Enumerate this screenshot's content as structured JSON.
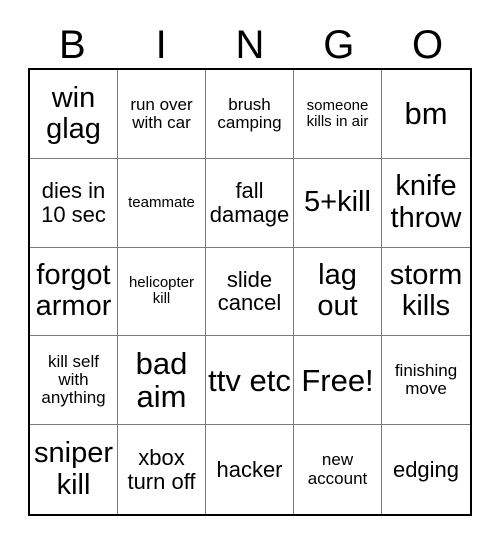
{
  "header": {
    "letters": [
      "B",
      "I",
      "N",
      "G",
      "O"
    ]
  },
  "grid": {
    "columns": 5,
    "rows": 5,
    "cells": [
      {
        "text": "win glag",
        "size": "fs-lg"
      },
      {
        "text": "run over with car",
        "size": "fs-sm"
      },
      {
        "text": "brush camping",
        "size": "fs-sm"
      },
      {
        "text": "someone kills in air",
        "size": "fs-xs"
      },
      {
        "text": "bm",
        "size": "fs-xl"
      },
      {
        "text": "dies in 10 sec",
        "size": "fs-md"
      },
      {
        "text": "teammate",
        "size": "fs-xs"
      },
      {
        "text": "fall damage",
        "size": "fs-md"
      },
      {
        "text": "5+kill",
        "size": "fs-lg"
      },
      {
        "text": "knife throw",
        "size": "fs-lg"
      },
      {
        "text": "forgot armor",
        "size": "fs-lg"
      },
      {
        "text": "helicopter kill",
        "size": "fs-xs"
      },
      {
        "text": "slide cancel",
        "size": "fs-md"
      },
      {
        "text": "lag out",
        "size": "fs-lg"
      },
      {
        "text": "storm kills",
        "size": "fs-lg"
      },
      {
        "text": "kill self with anything",
        "size": "fs-sm"
      },
      {
        "text": "bad aim",
        "size": "fs-xl"
      },
      {
        "text": "ttv etc",
        "size": "fs-xl"
      },
      {
        "text": "Free!",
        "size": "fs-xl"
      },
      {
        "text": "finishing move",
        "size": "fs-sm"
      },
      {
        "text": "sniper kill",
        "size": "fs-lg"
      },
      {
        "text": "xbox turn off",
        "size": "fs-md"
      },
      {
        "text": "hacker",
        "size": "fs-md"
      },
      {
        "text": "new account",
        "size": "fs-sm"
      },
      {
        "text": "edging",
        "size": "fs-md"
      }
    ]
  },
  "colors": {
    "background": "#ffffff",
    "text": "#000000",
    "inner_border": "#7a7a7a",
    "outer_border": "#000000"
  }
}
